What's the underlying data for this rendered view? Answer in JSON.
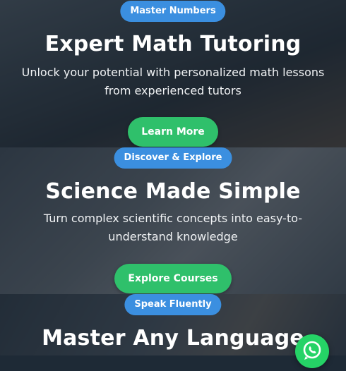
{
  "slides": [
    {
      "badge": "Master Numbers",
      "title": "Expert Math Tutoring",
      "description": "Unlock your potential with personalized math lessons from experienced tutors",
      "button": "Learn More"
    },
    {
      "badge": "Discover & Explore",
      "title": "Science Made Simple",
      "description": "Turn complex scientific concepts into easy-to-understand knowledge",
      "button": "Explore Courses"
    },
    {
      "badge": "Speak Fluently",
      "title": "Master Any Language"
    }
  ],
  "colors": {
    "badge": "#3b8fe0",
    "button": "#2fc06b",
    "whatsapp": "#25d366"
  },
  "icons": {
    "floating": "whatsapp-icon"
  }
}
